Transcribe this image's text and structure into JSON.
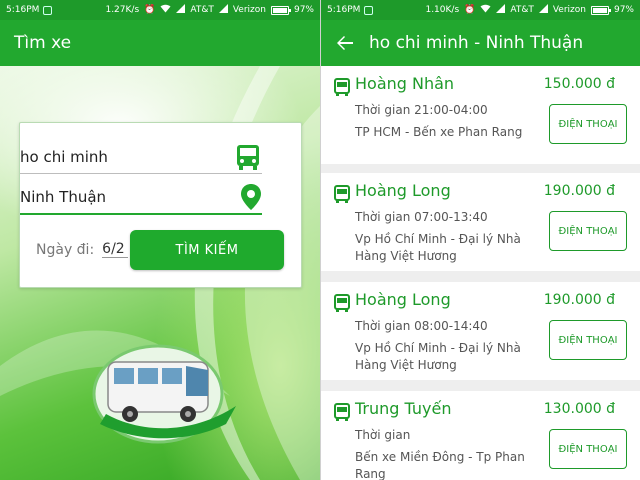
{
  "status_left": {
    "time": "5:16PM",
    "speed": "1.27K/s",
    "carrier1": "AT&T",
    "carrier2": "Verizon",
    "battery": "97%",
    "battery_level": 0.97
  },
  "status_right": {
    "time": "5:16PM",
    "speed": "1.10K/s",
    "carrier1": "AT&T",
    "carrier2": "Verizon",
    "battery": "97%",
    "battery_level": 0.97
  },
  "search_screen": {
    "title": "Tìm xe",
    "from_value": "ho chi minh",
    "to_value": "Ninh Thuận",
    "date_label": "Ngày đi:",
    "date_value": "6/2",
    "search_button": "TÌM KIẾM"
  },
  "results_screen": {
    "title": "ho chi minh - Ninh Thuận",
    "results": [
      {
        "operator": "Hoàng Nhân",
        "price": "150.000 đ",
        "time": "Thời gian 21:00-04:00",
        "route": "TP HCM - Bến xe Phan Rang",
        "call_label": "ĐIỆN THOẠI"
      },
      {
        "operator": "Hoàng Long",
        "price": "190.000 đ",
        "time": "Thời gian 07:00-13:40",
        "route": "Vp Hồ Chí Minh - Đại lý Nhà Hàng Việt Hương",
        "call_label": "ĐIỆN THOẠI"
      },
      {
        "operator": "Hoàng Long",
        "price": "190.000 đ",
        "time": "Thời gian 08:00-14:40",
        "route": "Vp Hồ Chí Minh - Đại lý Nhà Hàng Việt Hương",
        "call_label": "ĐIỆN THOẠI"
      },
      {
        "operator": "Trung Tuyến",
        "price": "130.000 đ",
        "time": "Thời gian",
        "route": "Bến xe Miền Đông - Tp Phan Rang",
        "call_label": "ĐIỆN THOẠI"
      }
    ]
  },
  "colors": {
    "primary": "#22a82f",
    "status_bar": "#1e9a2a",
    "accent_text": "#1e9a2a"
  },
  "icons": {
    "from_field": "bus-icon",
    "to_field": "location-pin-icon",
    "back": "arrow-left-icon",
    "result_operator": "bus-icon"
  }
}
